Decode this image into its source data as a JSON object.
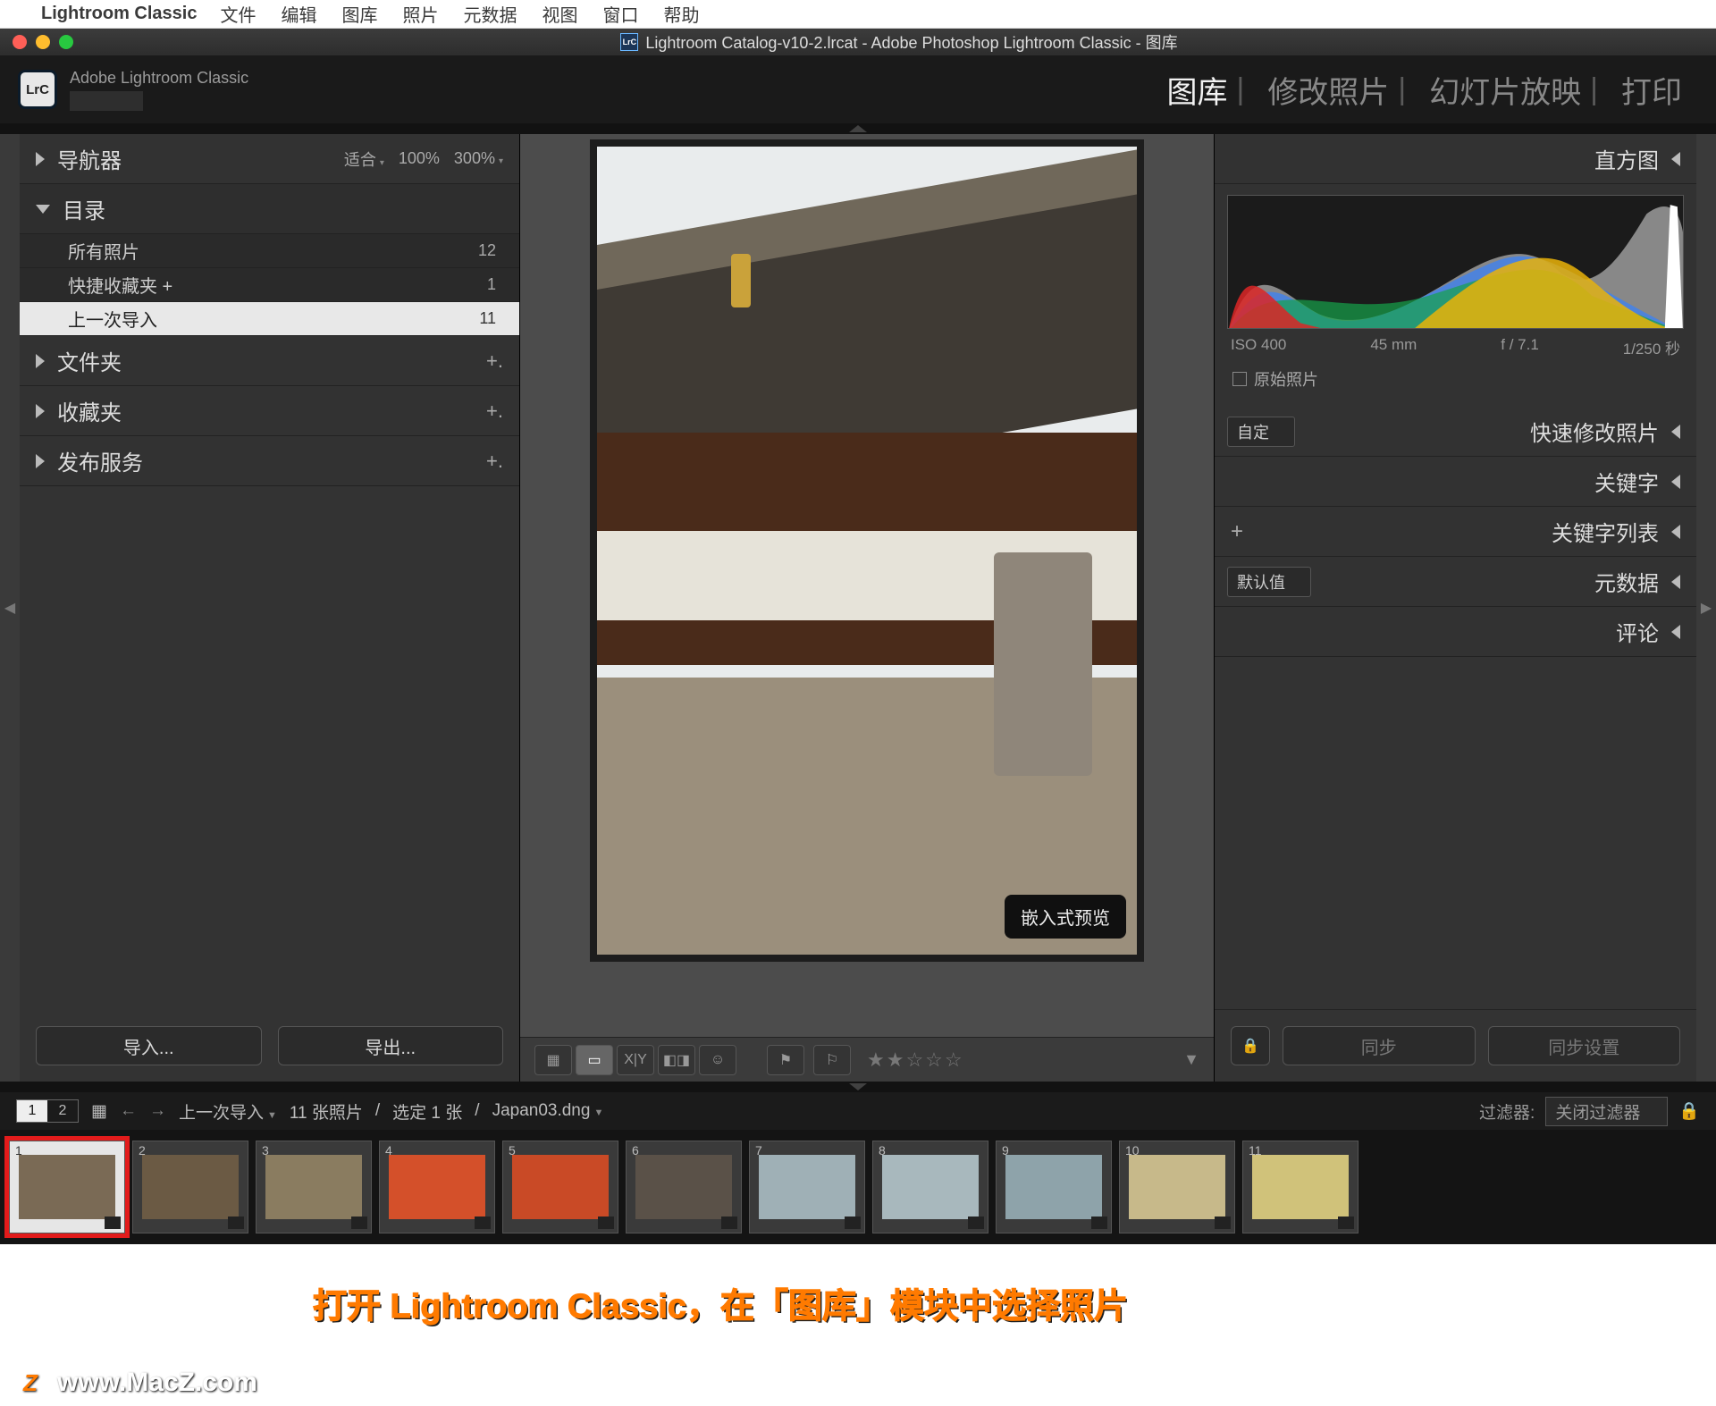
{
  "menubar": {
    "app": "Lightroom Classic",
    "items": [
      "文件",
      "编辑",
      "图库",
      "照片",
      "元数据",
      "视图",
      "窗口",
      "帮助"
    ]
  },
  "titlebar": {
    "document": "Lightroom Catalog-v10-2.lrcat - Adobe Photoshop Lightroom Classic - 图库",
    "badge": "LrC"
  },
  "identity": {
    "product": "Adobe Lightroom Classic",
    "badge": "LrC"
  },
  "modules": {
    "items": [
      "图库",
      "修改照片",
      "幻灯片放映",
      "打印"
    ],
    "active_index": 0
  },
  "left_panel": {
    "navigator": {
      "title": "导航器",
      "fit": "适合",
      "z100": "100%",
      "z300": "300%"
    },
    "catalog": {
      "title": "目录",
      "items": [
        {
          "label": "所有照片",
          "count": "12"
        },
        {
          "label": "快捷收藏夹 +",
          "count": "1"
        },
        {
          "label": "上一次导入",
          "count": "11"
        }
      ],
      "selected_index": 2
    },
    "folders": {
      "title": "文件夹",
      "plus": "+."
    },
    "collections": {
      "title": "收藏夹",
      "plus": "+."
    },
    "publish": {
      "title": "发布服务",
      "plus": "+."
    },
    "import_btn": "导入...",
    "export_btn": "导出..."
  },
  "center": {
    "preview_badge": "嵌入式预览"
  },
  "toolbar": {
    "grid": "grid",
    "loupe": "loupe",
    "compare": "X|Y",
    "survey": "survey",
    "people": "people",
    "flag": "⚑",
    "reject": "⚐",
    "stars": "★★☆☆☆"
  },
  "right_panel": {
    "histogram": {
      "title": "直方图",
      "iso": "ISO 400",
      "focal": "45 mm",
      "aperture": "f / 7.1",
      "shutter": "1/250 秒",
      "raw_label": "原始照片"
    },
    "quickdev": {
      "title": "快速修改照片",
      "preset": "自定"
    },
    "keywords": {
      "title": "关键字"
    },
    "keywordlist": {
      "title": "关键字列表",
      "plus": "+"
    },
    "metadata": {
      "title": "元数据",
      "preset": "默认值"
    },
    "comments": {
      "title": "评论"
    },
    "sync": "同步",
    "sync_settings": "同步设置"
  },
  "filmstrip": {
    "monitor_primary": "1",
    "monitor_secondary": "2",
    "source": "上一次导入",
    "count": "11 张照片",
    "selected": "选定 1 张",
    "filename": "Japan03.dng",
    "filter_label": "过滤器:",
    "filter_value": "关闭过滤器",
    "thumbs": [
      1,
      2,
      3,
      4,
      5,
      6,
      7,
      8,
      9,
      10,
      11
    ],
    "selected_index": 0
  },
  "annotation": "打开 Lightroom Classic，在「图库」模块中选择照片",
  "watermark": "www.MacZ.com"
}
